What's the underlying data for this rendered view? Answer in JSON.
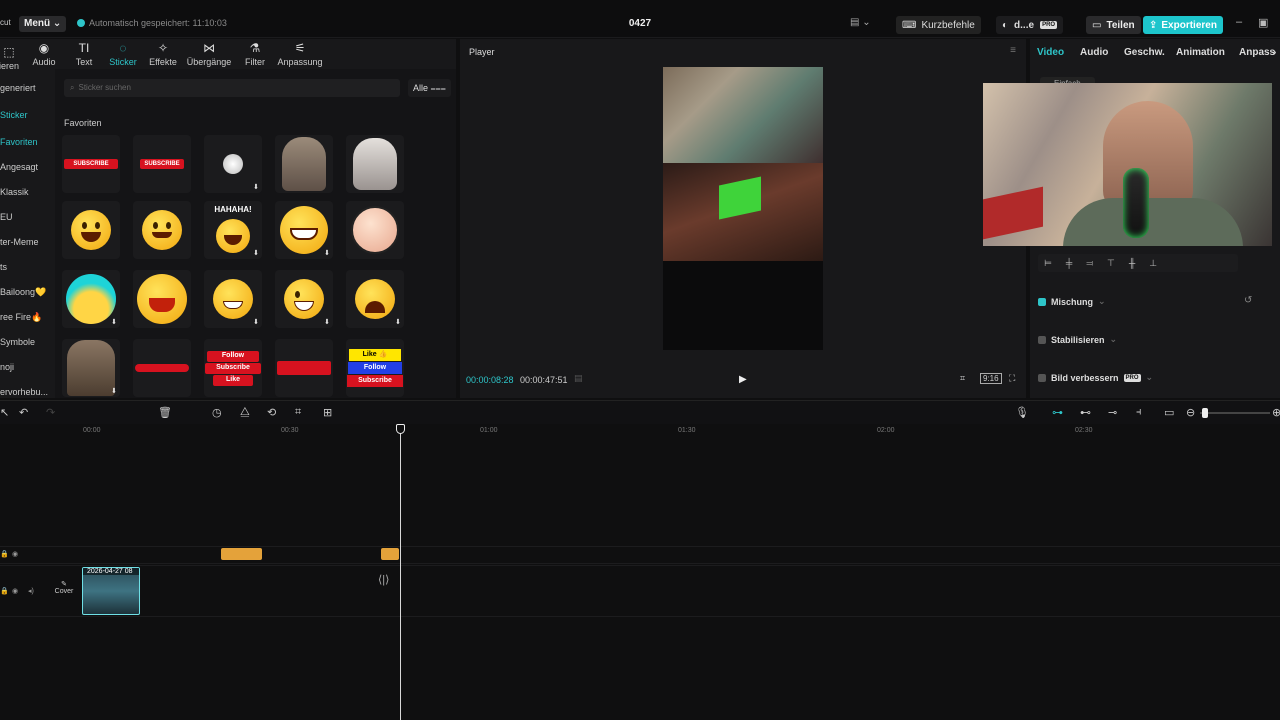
{
  "titlebar": {
    "logo": "cut",
    "menu_label": "Menü",
    "autosave": "Automatisch gespeichert: 11:10:03",
    "project_title": "0427",
    "layout_icon": "▤",
    "shortcuts_label": "Kurzbefehle",
    "user_label": "d...e",
    "user_badge": "PRO",
    "share_label": "Teilen",
    "export_label": "Exportieren"
  },
  "tool_tabs": [
    {
      "label": "ieren",
      "icon": "⬚"
    },
    {
      "label": "Audio",
      "icon": "◉"
    },
    {
      "label": "Text",
      "icon": "TI"
    },
    {
      "label": "Sticker",
      "icon": "◌"
    },
    {
      "label": "Effekte",
      "icon": "✧"
    },
    {
      "label": "Übergänge",
      "icon": "⋈"
    },
    {
      "label": "Filter",
      "icon": "⚗"
    },
    {
      "label": "Anpassung",
      "icon": "⚟"
    }
  ],
  "side_categories": [
    "generiert",
    "Sticker",
    "Favoriten",
    "Angesagt",
    "Klassik",
    "EU",
    "ter-Meme",
    "ts",
    "Bailoong💛",
    "ree Fire🔥",
    "Symbole",
    "noji",
    "ervorhebu..."
  ],
  "stickers": {
    "search_placeholder": "Sticker suchen",
    "filter_label": "Alle",
    "section_title": "Favoriten",
    "items": [
      "subscribe-red",
      "subscribe-bell",
      "white-dot",
      "cat-thumbs",
      "white-cat",
      "emoji-happy",
      "emoji-hug",
      "hahaha",
      "emoji-grin",
      "pig-face",
      "emoji-shocked",
      "emoji-laugh",
      "emoji-smile",
      "emoji-wink",
      "emoji-cry",
      "cat-meme",
      "red-bar",
      "follow-subscribe-like",
      "red-banner",
      "like-follow-subscribe"
    ],
    "texts": {
      "subscribe": "SUBSCRIBE",
      "hahaha": "HAHAHA!",
      "follow": "Follow",
      "subscribe2": "Subscribe",
      "like": "Like",
      "like_btn": "Like 👍",
      "follow2": "Follow",
      "subscribe3": "Subscribe"
    }
  },
  "player": {
    "title": "Player",
    "time_current": "00:00:08:28",
    "time_total": "00:00:47:51",
    "ratio": "9:16"
  },
  "right_panel": {
    "tabs": [
      "Video",
      "Audio",
      "Geschw.",
      "Animation",
      "Anpass"
    ],
    "subtab": "Einfach",
    "mischung": "Mischung",
    "stabilisieren": "Stabilisieren",
    "bild_verbessern": "Bild verbessern",
    "pro_badge": "PRO"
  },
  "timeline": {
    "ticks": [
      "00:00",
      "00:30",
      "01:00",
      "01:30",
      "02:00",
      "02:30"
    ],
    "video_clip_label": "2026-04-27 08",
    "cover_label": "Cover"
  }
}
